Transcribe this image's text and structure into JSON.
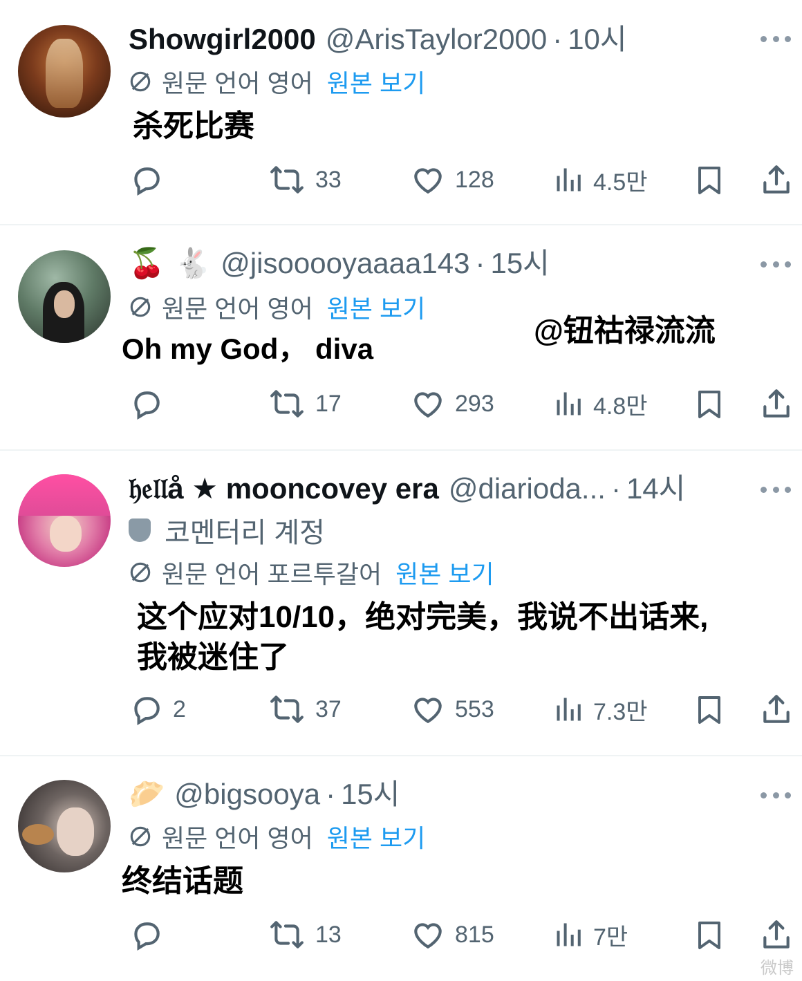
{
  "tweets": [
    {
      "display_name": "Showgirl2000",
      "handle": "@ArisTaylor2000",
      "separator": "·",
      "time": "10시",
      "translate_label": "원문 언어 영어",
      "view_original": "원본 보기",
      "content": "杀死比赛",
      "replies": "",
      "retweets": "33",
      "likes": "128",
      "views": "4.5만"
    },
    {
      "display_name": "🍒 🐇",
      "handle": "@jisooooyaaaa143",
      "separator": "·",
      "time": "15시",
      "translate_label": "원문 언어 영어",
      "view_original": "원본 보기",
      "content": "Oh my God， diva",
      "overlay": "@钮祜禄流流",
      "replies": "",
      "retweets": "17",
      "likes": "293",
      "views": "4.8만"
    },
    {
      "display_name": "𝔥𝔢𝔩𝔩å ★ mooncovey era",
      "handle": "@diarioda...",
      "separator": "·",
      "time": "14시",
      "commentary": "코멘터리 계정",
      "translate_label": "원문 언어 포르투갈어",
      "view_original": "원본 보기",
      "content_line1": "这个应对10/10，绝对完美，我说不出话来,",
      "content_line2": "我被迷住了",
      "replies": "2",
      "retweets": "37",
      "likes": "553",
      "views": "7.3만"
    },
    {
      "display_name": "🥟",
      "handle": "@bigsooya",
      "separator": "·",
      "time": "15시",
      "translate_label": "원문 언어 영어",
      "view_original": "원본 보기",
      "content": "终结话题",
      "replies": "",
      "retweets": "13",
      "likes": "815",
      "views": "7만"
    }
  ],
  "icons": {
    "reply": "reply-icon",
    "retweet": "retweet-icon",
    "like": "heart-icon",
    "views": "views-icon",
    "bookmark": "bookmark-icon",
    "share": "share-icon",
    "translate": "translate-icon",
    "more": "more-icon",
    "commentary": "theater-mask-icon"
  },
  "colors": {
    "link": "#1d9bf0",
    "muted": "#536471",
    "text": "#0f1419"
  },
  "watermark": "微博"
}
